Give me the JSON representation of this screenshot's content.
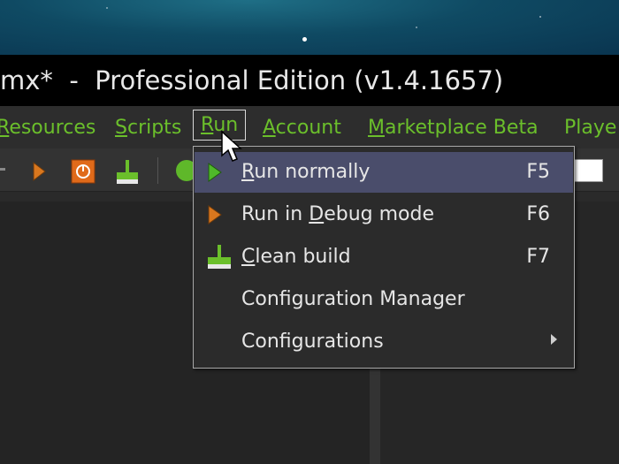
{
  "window": {
    "title_partial": "mx*  -  Professional Edition (v1.4.1657)"
  },
  "menubar": {
    "items": [
      {
        "label_pre": "",
        "label_ul": "R",
        "label_post": "esources"
      },
      {
        "label_pre": "",
        "label_ul": "S",
        "label_post": "cripts"
      },
      {
        "label_pre": "",
        "label_ul": "R",
        "label_post": "un"
      },
      {
        "label_pre": "",
        "label_ul": "A",
        "label_post": "ccount"
      },
      {
        "label_pre": "",
        "label_ul": "M",
        "label_post": "arketplace Beta"
      },
      {
        "label_pre": "Playe",
        "label_ul": "",
        "label_post": ""
      }
    ]
  },
  "run_menu": {
    "items": [
      {
        "pre": "",
        "ul": "R",
        "post": "un normally",
        "shortcut": "F5",
        "icon": "play-green-icon"
      },
      {
        "pre": "Run in ",
        "ul": "D",
        "post": "ebug mode",
        "shortcut": "F6",
        "icon": "play-orange-icon"
      },
      {
        "pre": "",
        "ul": "C",
        "post": "lean build",
        "shortcut": "F7",
        "icon": "broom-icon"
      },
      {
        "pre": "Configuration Manager",
        "ul": "",
        "post": "",
        "shortcut": "",
        "icon": ""
      },
      {
        "pre": "Configurations",
        "ul": "",
        "post": "",
        "shortcut": "",
        "icon": "submenu-arrow-icon"
      }
    ]
  },
  "colors": {
    "menu_text": "#6bbf2b",
    "highlight": "#4a4d6b",
    "title_bar": "#000000"
  }
}
